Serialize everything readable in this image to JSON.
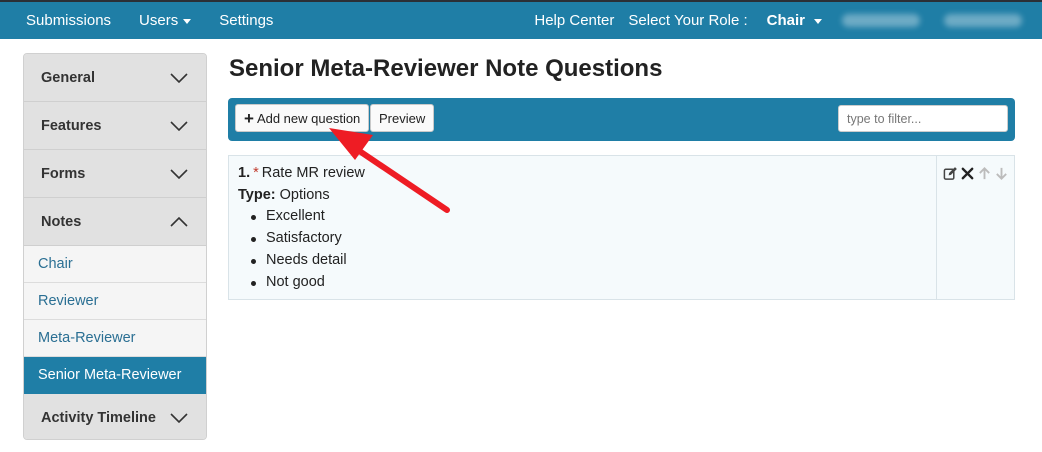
{
  "navbar": {
    "submissions": "Submissions",
    "users": "Users",
    "settings": "Settings",
    "help_center": "Help Center",
    "role_label": "Select Your Role :",
    "role_value": "Chair"
  },
  "sidebar": {
    "general": "General",
    "features": "Features",
    "forms": "Forms",
    "notes": "Notes",
    "notes_items": [
      "Chair",
      "Reviewer",
      "Meta-Reviewer",
      "Senior Meta-Reviewer"
    ],
    "activity_timeline": "Activity Timeline"
  },
  "main": {
    "title": "Senior Meta-Reviewer Note Questions",
    "add_button": "Add new question",
    "preview_button": "Preview",
    "filter_placeholder": "type to filter..."
  },
  "question": {
    "number": "1.",
    "required_mark": "*",
    "title": "Rate MR review",
    "type_label": "Type:",
    "type_value": "Options",
    "options": [
      "Excellent",
      "Satisfactory",
      "Needs detail",
      "Not good"
    ]
  },
  "colors": {
    "brand": "#1f7ea6",
    "annotation_arrow": "#ee1c24"
  }
}
